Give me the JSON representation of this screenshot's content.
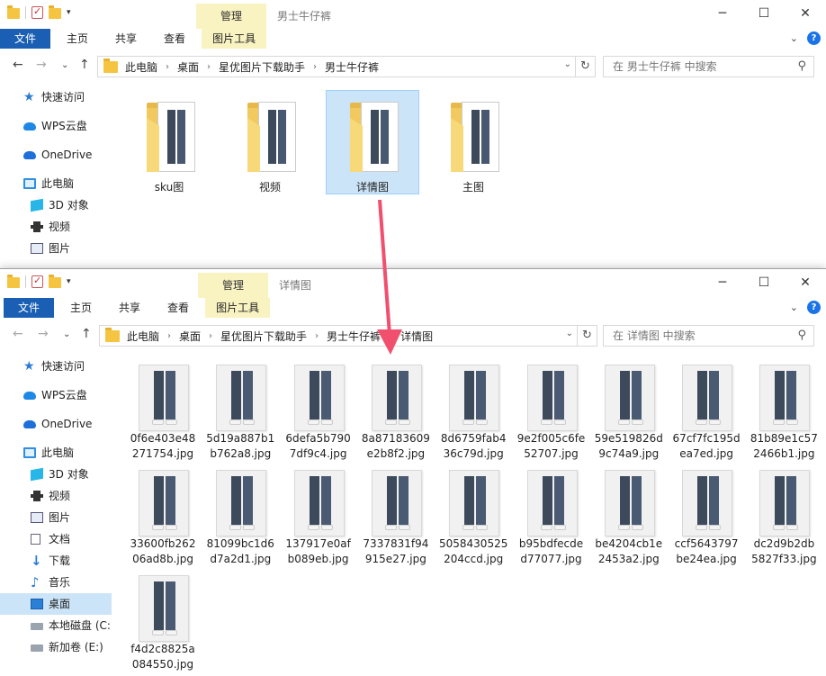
{
  "top_window": {
    "manage_tab": "管理",
    "title": "男士牛仔裤",
    "ribbon_tabs": [
      "文件",
      "主页",
      "共享",
      "查看",
      "图片工具"
    ],
    "breadcrumb": [
      "此电脑",
      "桌面",
      "星优图片下载助手",
      "男士牛仔裤"
    ],
    "search_placeholder": "在 男士牛仔裤 中搜索",
    "sidebar": [
      "快速访问",
      "WPS云盘",
      "OneDrive",
      "此电脑",
      "3D 对象",
      "视频",
      "图片"
    ],
    "folders": [
      {
        "name": "sku图",
        "selected": false
      },
      {
        "name": "视频",
        "selected": false
      },
      {
        "name": "详情图",
        "selected": true
      },
      {
        "name": "主图",
        "selected": false
      }
    ]
  },
  "bottom_window": {
    "manage_tab": "管理",
    "title": "详情图",
    "ribbon_tabs": [
      "文件",
      "主页",
      "共享",
      "查看",
      "图片工具"
    ],
    "breadcrumb": [
      "此电脑",
      "桌面",
      "星优图片下载助手",
      "男士牛仔裤",
      "详情图"
    ],
    "search_placeholder": "在 详情图 中搜索",
    "sidebar": [
      "快速访问",
      "WPS云盘",
      "OneDrive",
      "此电脑",
      "3D 对象",
      "视频",
      "图片",
      "文档",
      "下载",
      "音乐",
      "桌面",
      "本地磁盘 (C:)",
      "新加卷 (E:)"
    ],
    "active_sidebar": "桌面",
    "files": [
      [
        "0f6e403e48",
        "271754.jpg"
      ],
      [
        "5d19a887b1",
        "b762a8.jpg"
      ],
      [
        "6defa5b790",
        "7df9c4.jpg"
      ],
      [
        "8a87183609",
        "e2b8f2.jpg"
      ],
      [
        "8d6759fab4",
        "36c79d.jpg"
      ],
      [
        "9e2f005c6fe",
        "52707.jpg"
      ],
      [
        "59e519826d",
        "9c74a9.jpg"
      ],
      [
        "67cf7fc195d",
        "ea7ed.jpg"
      ],
      [
        "81b89e1c57",
        "2466b1.jpg"
      ],
      [
        "33600fb262",
        "06ad8b.jpg"
      ],
      [
        "81099bc1d6",
        "d7a2d1.jpg"
      ],
      [
        "137917e0af",
        "b089eb.jpg"
      ],
      [
        "7337831f94",
        "915e27.jpg"
      ],
      [
        "5058430525",
        "204ccd.jpg"
      ],
      [
        "b95bdfecde",
        "d77077.jpg"
      ],
      [
        "be4204cb1e",
        "2453a2.jpg"
      ],
      [
        "ccf5643797",
        "be24ea.jpg"
      ],
      [
        "dc2d9b2db",
        "5827f33.jpg"
      ],
      [
        "f4d2c8825a",
        "084550.jpg"
      ]
    ]
  },
  "colors": {
    "file_tab": "#1a5fb4",
    "manage_tab": "#f9f3c2",
    "selection": "#cce4f7",
    "arrow": "#f0506e",
    "folder": "#f2c95f"
  }
}
